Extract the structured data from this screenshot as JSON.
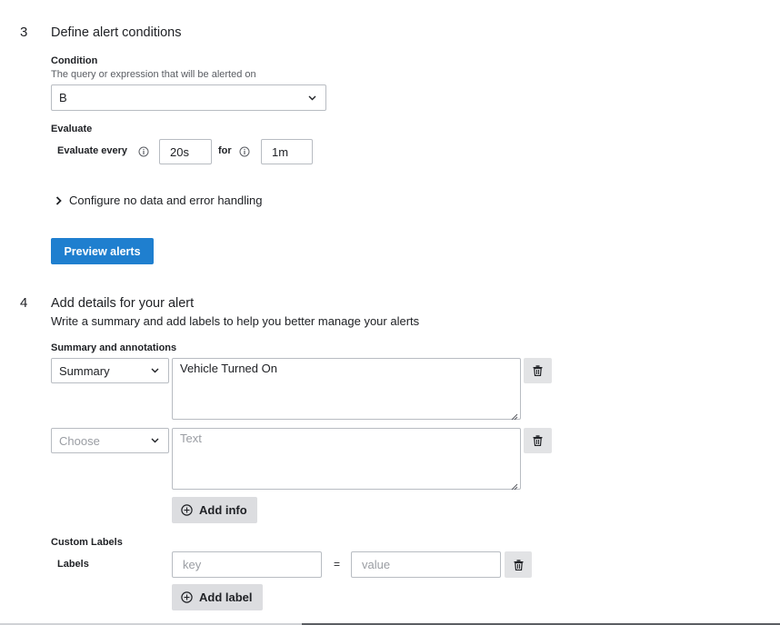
{
  "step3": {
    "number": "3",
    "title": "Define alert conditions",
    "condition": {
      "label": "Condition",
      "description": "The query or expression that will be alerted on",
      "value": "B"
    },
    "evaluate": {
      "label": "Evaluate",
      "every_label": "Evaluate every",
      "every_value": "20s",
      "for_label": "for",
      "for_value": "1m"
    },
    "no_data_toggle": "Configure no data and error handling",
    "preview_button": "Preview alerts"
  },
  "step4": {
    "number": "4",
    "title": "Add details for your alert",
    "subtitle": "Write a summary and add labels to help you better manage your alerts",
    "annotations": {
      "label": "Summary and annotations",
      "rows": [
        {
          "key": "Summary",
          "value": "Vehicle Turned On"
        },
        {
          "key_placeholder": "Choose",
          "value_placeholder": "Text"
        }
      ],
      "add_info": "Add info"
    },
    "custom_labels": {
      "label": "Custom Labels",
      "labels_label": "Labels",
      "key_placeholder": "key",
      "equals": "=",
      "value_placeholder": "value",
      "add_label": "Add label"
    }
  },
  "colors": {
    "primary": "#1f7fcf",
    "border": "#b8bcc2",
    "button_gray": "#dcdde0"
  }
}
